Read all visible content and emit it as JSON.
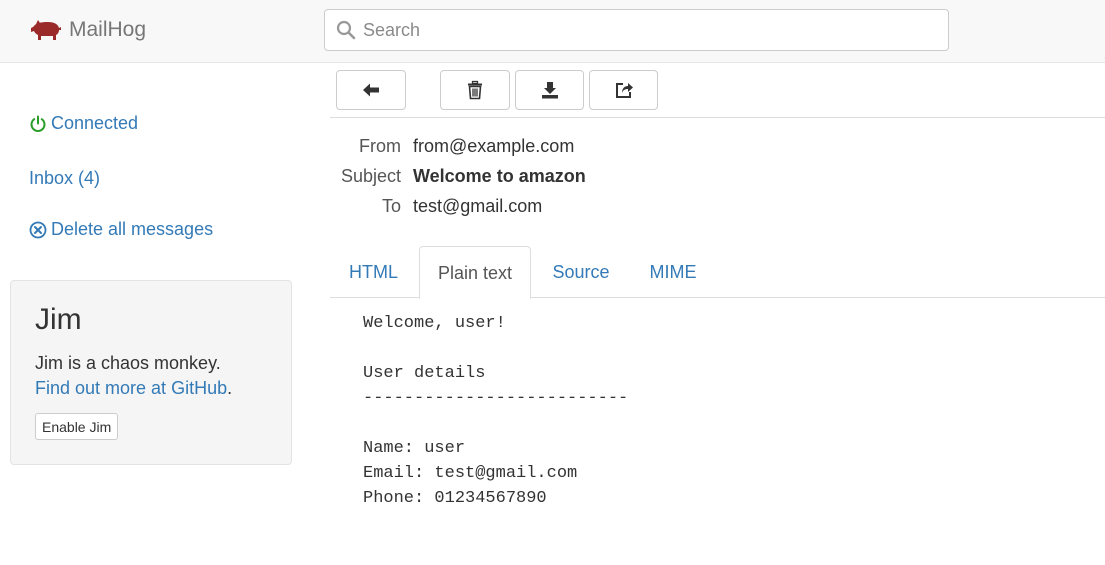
{
  "navbar": {
    "brand": "MailHog",
    "search_placeholder": "Search"
  },
  "sidebar": {
    "connected": "Connected",
    "inbox": "Inbox (4)",
    "delete_all": "Delete all messages"
  },
  "jim": {
    "title": "Jim",
    "description": "Jim is a chaos monkey.",
    "link_text": "Find out more at GitHub",
    "link_suffix": ".",
    "button": "Enable Jim"
  },
  "message": {
    "from_label": "From",
    "from": "from@example.com",
    "subject_label": "Subject",
    "subject": "Welcome to amazon",
    "to_label": "To",
    "to": "test@gmail.com"
  },
  "tabs": [
    "HTML",
    "Plain text",
    "Source",
    "MIME"
  ],
  "active_tab": "Plain text",
  "body_lines": [
    "Welcome, user!",
    "",
    "User details",
    "--------------------------",
    "",
    "Name: user",
    "Email: test@gmail.com",
    "Phone: 01234567890"
  ],
  "colors": {
    "link": "#337ab7",
    "brand_pig": "#9a2a2a",
    "connected_icon": "#2a9d2a"
  },
  "icons": {
    "brand": "pig-icon",
    "search": "search-icon",
    "connected": "power-icon",
    "delete_all": "remove-circle-icon",
    "back": "arrow-left-icon",
    "delete": "trash-icon",
    "download": "download-icon",
    "share": "share-icon"
  }
}
